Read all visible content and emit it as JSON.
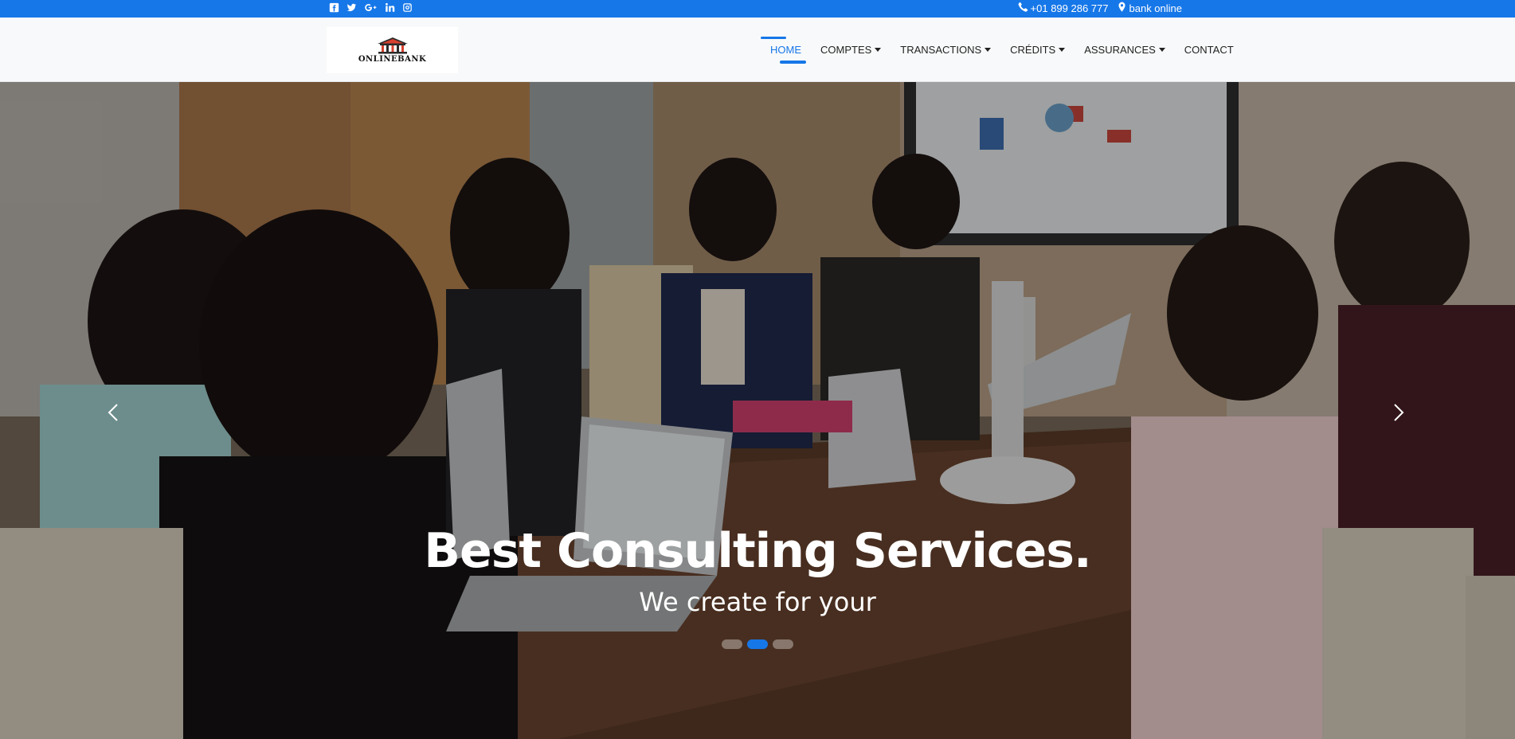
{
  "topbar": {
    "social_icons": [
      "facebook-icon",
      "twitter-icon",
      "google-plus-icon",
      "linkedin-icon",
      "instagram-icon"
    ],
    "phone": "+01 899 286 777",
    "location": "bank online"
  },
  "logo": {
    "text": "ONLINEBANK"
  },
  "nav": {
    "items": [
      {
        "label": "HOME",
        "active": true,
        "dropdown": false
      },
      {
        "label": "COMPTES",
        "active": false,
        "dropdown": true
      },
      {
        "label": "TRANSACTIONS",
        "active": false,
        "dropdown": true
      },
      {
        "label": "CRÉDITS",
        "active": false,
        "dropdown": true
      },
      {
        "label": "ASSURANCES",
        "active": false,
        "dropdown": true
      },
      {
        "label": "CONTACT",
        "active": false,
        "dropdown": false
      }
    ]
  },
  "hero": {
    "title": "Best Consulting Services.",
    "subtitle": "We create for your",
    "slides": 3,
    "active_slide": 2
  },
  "colors": {
    "accent": "#1677e8",
    "navbar_bg": "#f8f9fa"
  }
}
